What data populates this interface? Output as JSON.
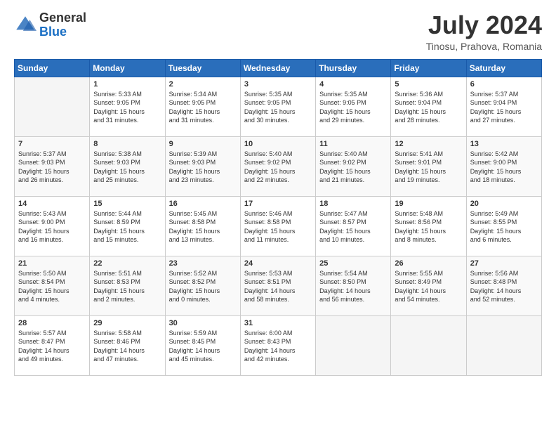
{
  "header": {
    "logo_general": "General",
    "logo_blue": "Blue",
    "month_title": "July 2024",
    "location": "Tinosu, Prahova, Romania"
  },
  "days_of_week": [
    "Sunday",
    "Monday",
    "Tuesday",
    "Wednesday",
    "Thursday",
    "Friday",
    "Saturday"
  ],
  "weeks": [
    [
      {
        "day": "",
        "info": ""
      },
      {
        "day": "1",
        "info": "Sunrise: 5:33 AM\nSunset: 9:05 PM\nDaylight: 15 hours\nand 31 minutes."
      },
      {
        "day": "2",
        "info": "Sunrise: 5:34 AM\nSunset: 9:05 PM\nDaylight: 15 hours\nand 31 minutes."
      },
      {
        "day": "3",
        "info": "Sunrise: 5:35 AM\nSunset: 9:05 PM\nDaylight: 15 hours\nand 30 minutes."
      },
      {
        "day": "4",
        "info": "Sunrise: 5:35 AM\nSunset: 9:05 PM\nDaylight: 15 hours\nand 29 minutes."
      },
      {
        "day": "5",
        "info": "Sunrise: 5:36 AM\nSunset: 9:04 PM\nDaylight: 15 hours\nand 28 minutes."
      },
      {
        "day": "6",
        "info": "Sunrise: 5:37 AM\nSunset: 9:04 PM\nDaylight: 15 hours\nand 27 minutes."
      }
    ],
    [
      {
        "day": "7",
        "info": "Sunrise: 5:37 AM\nSunset: 9:03 PM\nDaylight: 15 hours\nand 26 minutes."
      },
      {
        "day": "8",
        "info": "Sunrise: 5:38 AM\nSunset: 9:03 PM\nDaylight: 15 hours\nand 25 minutes."
      },
      {
        "day": "9",
        "info": "Sunrise: 5:39 AM\nSunset: 9:03 PM\nDaylight: 15 hours\nand 23 minutes."
      },
      {
        "day": "10",
        "info": "Sunrise: 5:40 AM\nSunset: 9:02 PM\nDaylight: 15 hours\nand 22 minutes."
      },
      {
        "day": "11",
        "info": "Sunrise: 5:40 AM\nSunset: 9:02 PM\nDaylight: 15 hours\nand 21 minutes."
      },
      {
        "day": "12",
        "info": "Sunrise: 5:41 AM\nSunset: 9:01 PM\nDaylight: 15 hours\nand 19 minutes."
      },
      {
        "day": "13",
        "info": "Sunrise: 5:42 AM\nSunset: 9:00 PM\nDaylight: 15 hours\nand 18 minutes."
      }
    ],
    [
      {
        "day": "14",
        "info": "Sunrise: 5:43 AM\nSunset: 9:00 PM\nDaylight: 15 hours\nand 16 minutes."
      },
      {
        "day": "15",
        "info": "Sunrise: 5:44 AM\nSunset: 8:59 PM\nDaylight: 15 hours\nand 15 minutes."
      },
      {
        "day": "16",
        "info": "Sunrise: 5:45 AM\nSunset: 8:58 PM\nDaylight: 15 hours\nand 13 minutes."
      },
      {
        "day": "17",
        "info": "Sunrise: 5:46 AM\nSunset: 8:58 PM\nDaylight: 15 hours\nand 11 minutes."
      },
      {
        "day": "18",
        "info": "Sunrise: 5:47 AM\nSunset: 8:57 PM\nDaylight: 15 hours\nand 10 minutes."
      },
      {
        "day": "19",
        "info": "Sunrise: 5:48 AM\nSunset: 8:56 PM\nDaylight: 15 hours\nand 8 minutes."
      },
      {
        "day": "20",
        "info": "Sunrise: 5:49 AM\nSunset: 8:55 PM\nDaylight: 15 hours\nand 6 minutes."
      }
    ],
    [
      {
        "day": "21",
        "info": "Sunrise: 5:50 AM\nSunset: 8:54 PM\nDaylight: 15 hours\nand 4 minutes."
      },
      {
        "day": "22",
        "info": "Sunrise: 5:51 AM\nSunset: 8:53 PM\nDaylight: 15 hours\nand 2 minutes."
      },
      {
        "day": "23",
        "info": "Sunrise: 5:52 AM\nSunset: 8:52 PM\nDaylight: 15 hours\nand 0 minutes."
      },
      {
        "day": "24",
        "info": "Sunrise: 5:53 AM\nSunset: 8:51 PM\nDaylight: 14 hours\nand 58 minutes."
      },
      {
        "day": "25",
        "info": "Sunrise: 5:54 AM\nSunset: 8:50 PM\nDaylight: 14 hours\nand 56 minutes."
      },
      {
        "day": "26",
        "info": "Sunrise: 5:55 AM\nSunset: 8:49 PM\nDaylight: 14 hours\nand 54 minutes."
      },
      {
        "day": "27",
        "info": "Sunrise: 5:56 AM\nSunset: 8:48 PM\nDaylight: 14 hours\nand 52 minutes."
      }
    ],
    [
      {
        "day": "28",
        "info": "Sunrise: 5:57 AM\nSunset: 8:47 PM\nDaylight: 14 hours\nand 49 minutes."
      },
      {
        "day": "29",
        "info": "Sunrise: 5:58 AM\nSunset: 8:46 PM\nDaylight: 14 hours\nand 47 minutes."
      },
      {
        "day": "30",
        "info": "Sunrise: 5:59 AM\nSunset: 8:45 PM\nDaylight: 14 hours\nand 45 minutes."
      },
      {
        "day": "31",
        "info": "Sunrise: 6:00 AM\nSunset: 8:43 PM\nDaylight: 14 hours\nand 42 minutes."
      },
      {
        "day": "",
        "info": ""
      },
      {
        "day": "",
        "info": ""
      },
      {
        "day": "",
        "info": ""
      }
    ]
  ]
}
